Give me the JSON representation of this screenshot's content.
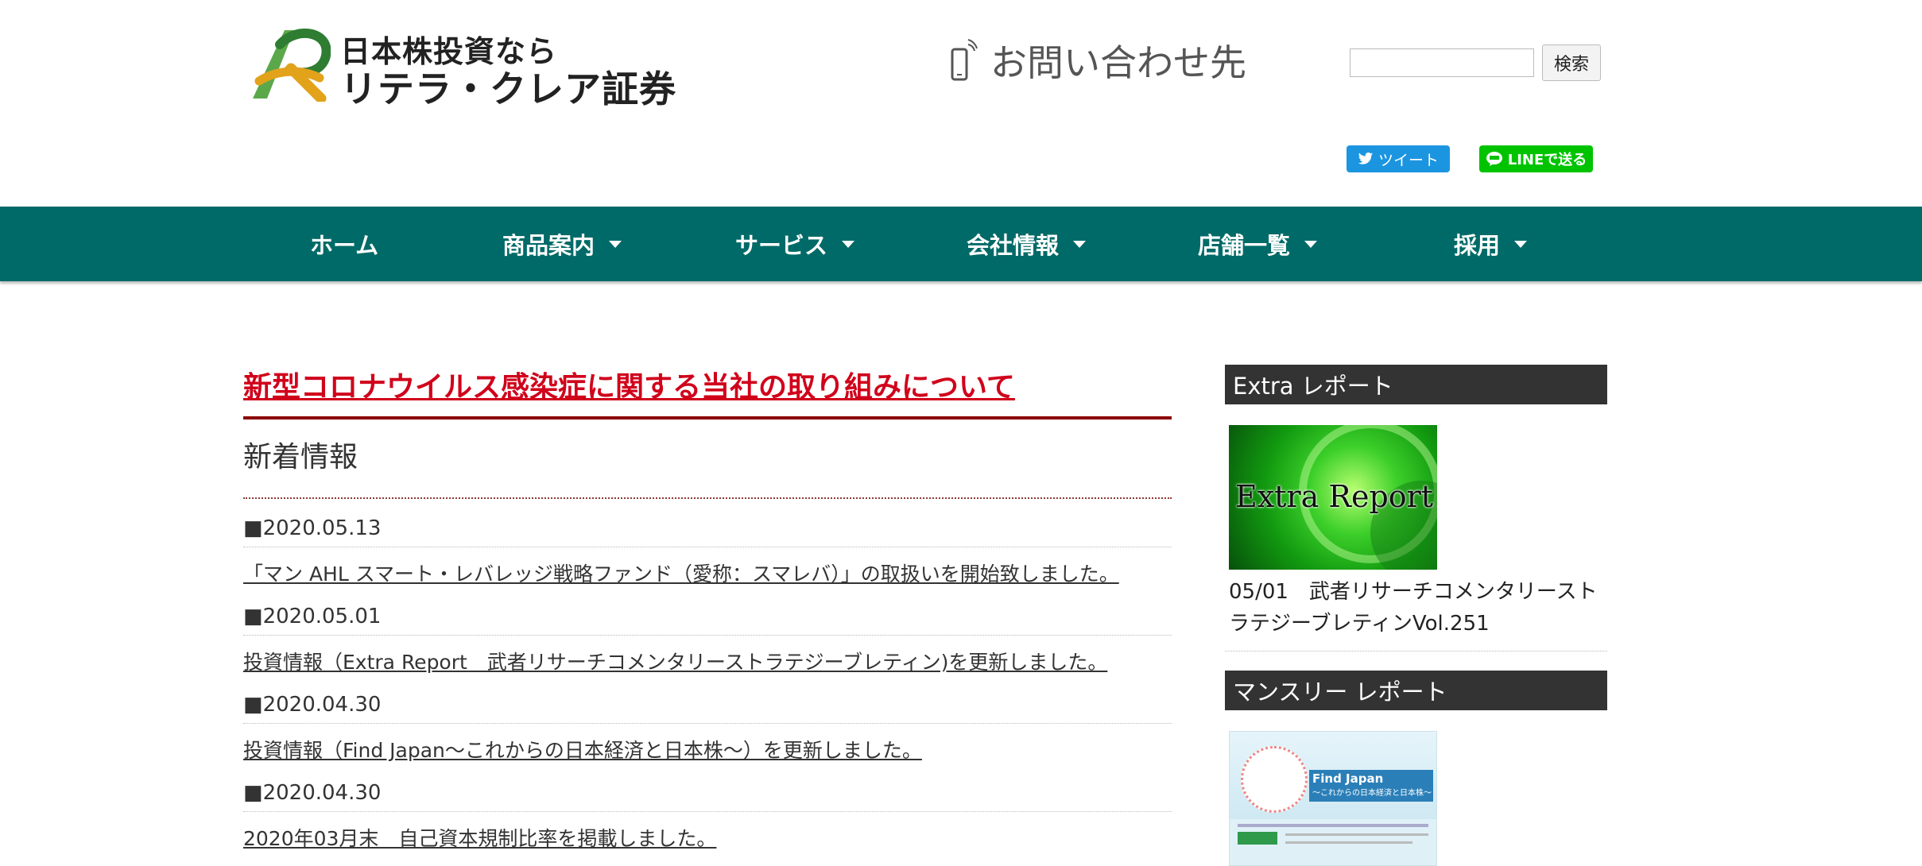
{
  "header": {
    "logo_line1": "日本株投資なら",
    "logo_line2": "リテラ・クレア証券",
    "contact_label": "お問い合わせ先",
    "search_placeholder": "",
    "search_button": "検索",
    "tweet_button": "ツイート",
    "line_button": "LINEで送る"
  },
  "nav": {
    "items": [
      {
        "label": "ホーム"
      },
      {
        "label": "商品案内"
      },
      {
        "label": "サービス"
      },
      {
        "label": "会社情報"
      },
      {
        "label": "店舗一覧"
      },
      {
        "label": "採用"
      }
    ]
  },
  "main": {
    "covid_link": "新型コロナウイルス感染症に関する当社の取り組みについて",
    "news_title": "新着情報",
    "news": [
      {
        "date": "■2020.05.13",
        "text": "「マン AHL スマート・レバレッジ戦略ファンド（愛称：スマレバ）」の取扱いを開始致しました。"
      },
      {
        "date": "■2020.05.01",
        "text": "投資情報（Extra Report　武者リサーチコメンタリーストラテジーブレティン)を更新しました。"
      },
      {
        "date": "■2020.04.30",
        "text": "投資情報（Find Japan～これからの日本経済と日本株～）を更新しました。"
      },
      {
        "date": "■2020.04.30",
        "text": "2020年03月末　自己資本規制比率を掲載しました。"
      }
    ]
  },
  "sidebar": {
    "extra_heading": "Extra レポート",
    "extra_thumb_text": "Extra Report",
    "extra_caption": "05/01　武者リサーチコメンタリーストラテジーブレティンVol.251",
    "monthly_heading": "マンスリー レポート",
    "monthly_thumb_title": "Find Japan",
    "monthly_thumb_subtitle": "〜これからの日本経済と日本株〜"
  },
  "colors": {
    "nav_bg": "#006a68",
    "covid_red": "#d0021b",
    "sidebar_heading_bg": "#333333",
    "tweet_blue": "#1b95e0",
    "line_green": "#00c300"
  }
}
